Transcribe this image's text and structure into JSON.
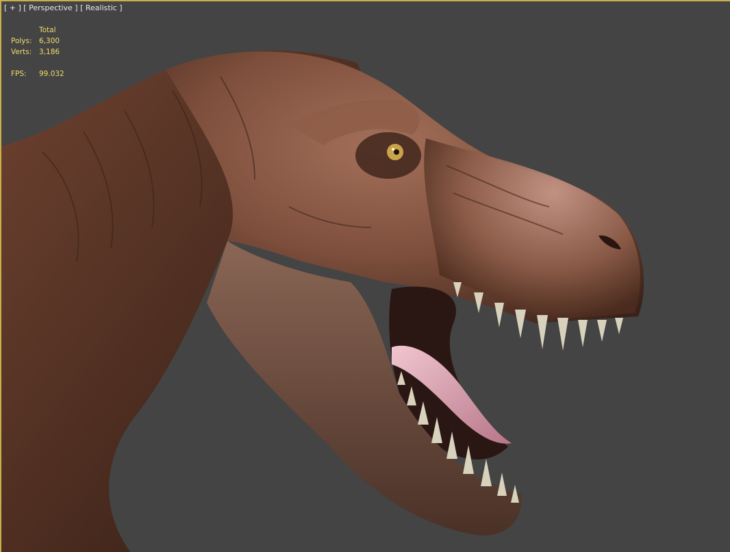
{
  "viewport": {
    "menu_label": "[ + ]",
    "view_label": "[ Perspective ]",
    "shading_label": "[ Realistic ]"
  },
  "stats": {
    "header": "Total",
    "polys_label": "Polys:",
    "polys_value": "6,300",
    "verts_label": "Verts:",
    "verts_value": "3,186",
    "fps_label": "FPS:",
    "fps_value": "99.032"
  },
  "colors": {
    "background": "#444444",
    "viewport_border": "#c8b04a",
    "stats_text": "#f0dc6e",
    "label_text": "#e8e8e8",
    "skin": "#8a5a44",
    "tongue": "#d9a3b0",
    "teeth": "#d8d2bd"
  },
  "scene": {
    "subject": "t-rex-head-model"
  }
}
